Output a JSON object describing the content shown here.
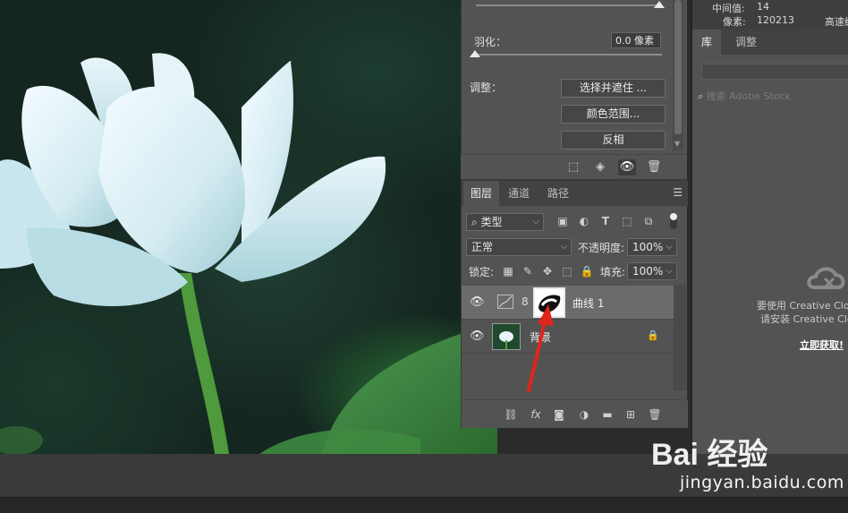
{
  "properties": {
    "feather_label": "羽化：",
    "feather_value": "0.0 像素",
    "adjust_label": "调整：",
    "btn_select_mask": "选择并遮住 ...",
    "btn_color_range": "颜色范围...",
    "btn_invert": "反相"
  },
  "layers_panel": {
    "tabs": [
      "图层",
      "通道",
      "路径"
    ],
    "filter_kind": "类型",
    "blend_mode": "正常",
    "opacity_label": "不透明度:",
    "opacity_value": "100%",
    "lock_label": "锁定:",
    "fill_label": "填充:",
    "fill_value": "100%",
    "layers": [
      {
        "name": "曲线 1",
        "selected": true
      },
      {
        "name": "背景",
        "selected": false
      }
    ]
  },
  "info_panel": {
    "median_label": "中间值:",
    "median_value": "14",
    "pixels_label": "像素:",
    "pixels_value": "120213",
    "cache_label": "高速缓"
  },
  "libraries_panel": {
    "tabs": [
      "库",
      "调整"
    ],
    "search_placeholder": "搜索 Adobe Stock",
    "cc_line1": "要使用 Creative Cloud",
    "cc_line2": "请安装 Creative Cloud",
    "cc_link": "立即获取!"
  },
  "watermark": {
    "logo": "Bai  经验",
    "url": "jingyan.baidu.com"
  },
  "icons": {
    "eye": "eye-icon",
    "lock": "lock-icon",
    "chain": "link-icon",
    "trash": "trash-icon"
  }
}
